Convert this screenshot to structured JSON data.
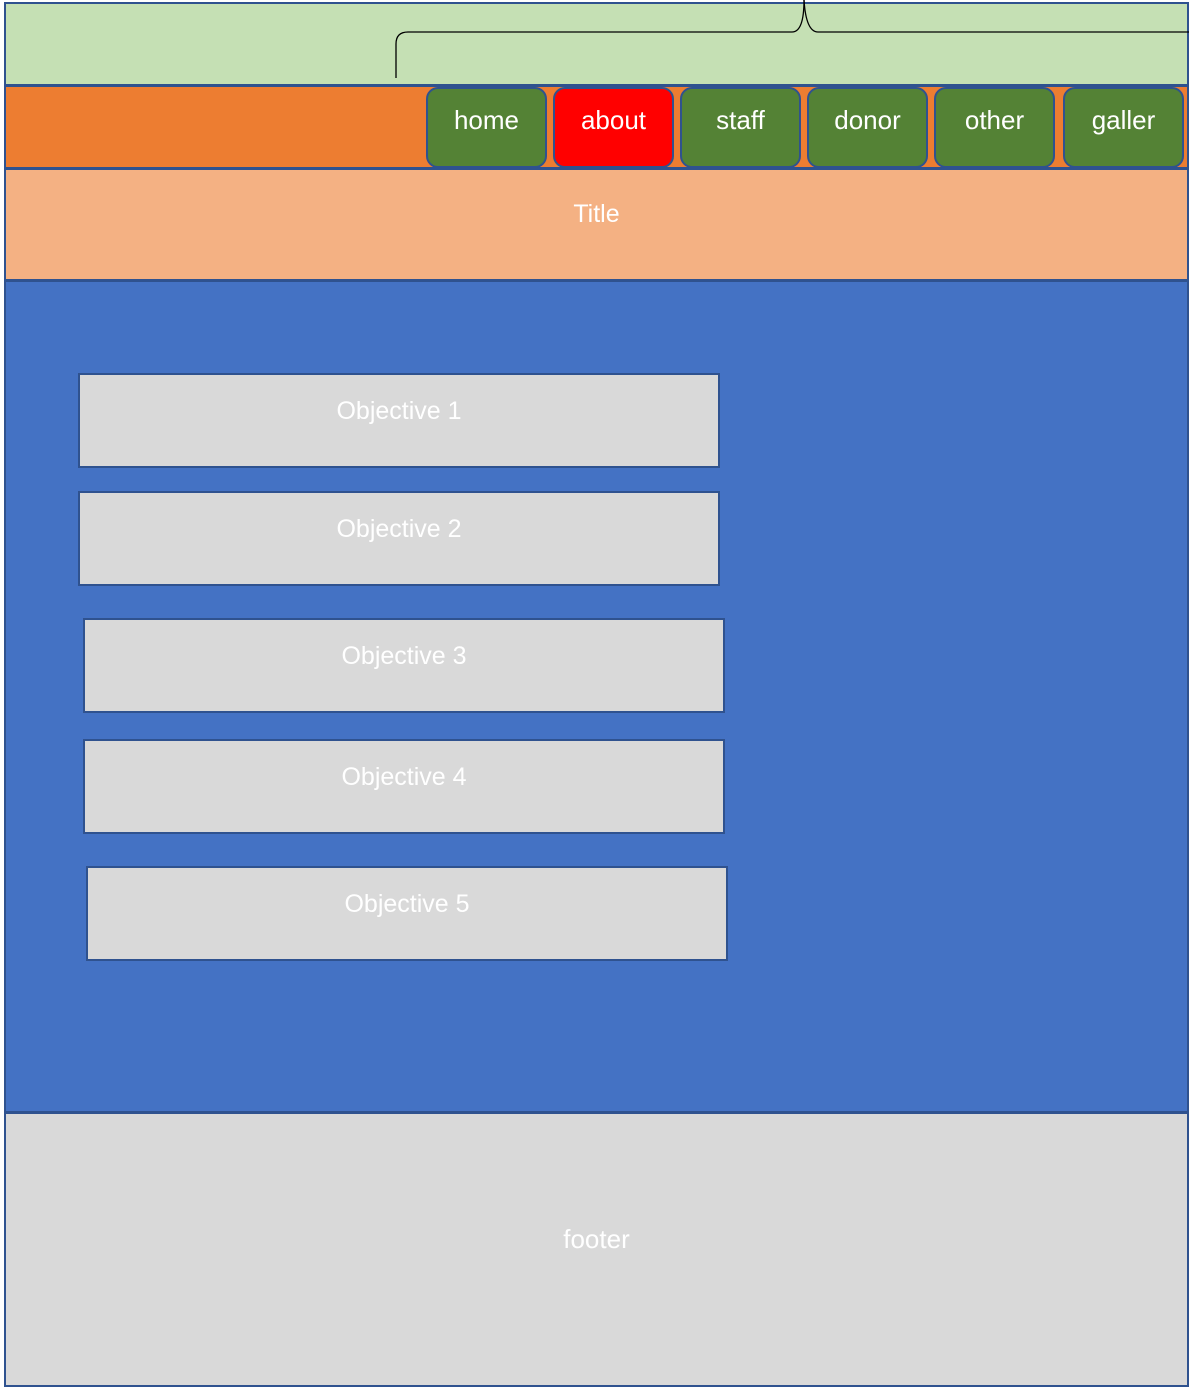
{
  "nav": {
    "items": [
      {
        "label": "home",
        "active": false
      },
      {
        "label": "about",
        "active": true
      },
      {
        "label": "staff",
        "active": false
      },
      {
        "label": "donor",
        "active": false
      },
      {
        "label": "other",
        "active": false
      },
      {
        "label": "galler",
        "active": false
      }
    ]
  },
  "title": {
    "text": "Title"
  },
  "objectives": [
    {
      "label": "Objective 1"
    },
    {
      "label": "Objective 2"
    },
    {
      "label": "Objective 3"
    },
    {
      "label": "Objective 4"
    },
    {
      "label": "Objective 5"
    }
  ],
  "footer": {
    "text": "footer"
  },
  "colors": {
    "header_bg": "#c5e0b4",
    "nav_bg": "#ed7d31",
    "nav_button": "#548235",
    "nav_button_active": "#ff0000",
    "title_bg": "#f4b183",
    "main_bg": "#4472c4",
    "box_bg": "#d9d9d9",
    "border": "#2f528f"
  }
}
